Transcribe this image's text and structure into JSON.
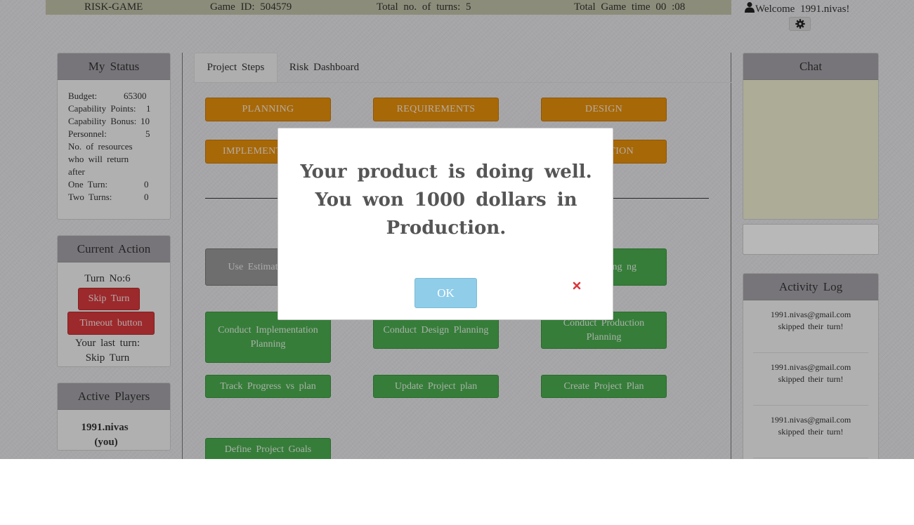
{
  "topbar": {
    "app_name": "RISK-GAME",
    "game_id": "Game ID: 504579",
    "turns": "Total no. of turns: 5",
    "game_time": "Total Game time 00 :08"
  },
  "user": {
    "welcome": "Welcome  1991.nivas!"
  },
  "status": {
    "title": "My Status",
    "rows": [
      {
        "label": "Budget:",
        "value": "65300"
      },
      {
        "label": "Capability Points:",
        "value": "1"
      },
      {
        "label": "Capability Bonus:",
        "value": "10"
      },
      {
        "label": "Personnel:",
        "value": "5"
      }
    ],
    "returning_label_1": "No. of resources",
    "returning_label_2": "who will return",
    "returning_label_3": "after",
    "one_turn_label": "One Turn:",
    "one_turn_value": "0",
    "two_turns_label": "Two Turns:",
    "two_turns_value": "0"
  },
  "current_action": {
    "title": "Current Action",
    "turn_no": "Turn No:6",
    "skip_turn": "Skip Turn",
    "timeout": "Timeout button",
    "last_turn_label": "Your last turn:",
    "last_turn_value": "Skip Turn"
  },
  "active_players": {
    "title": "Active Players",
    "player_name": "1991.nivas",
    "player_tag": "(you)"
  },
  "tabs": [
    "Project Steps",
    "Risk Dashboard"
  ],
  "phases": [
    "PLANNING",
    "REQUIREMENTS",
    "DESIGN",
    "IMPLEMENT",
    "TION"
  ],
  "actions": {
    "use_estimates": "Use Estimates Plan",
    "testing_partial": "esting ng",
    "conduct_impl": "Conduct Implementation Planning",
    "conduct_design": "Conduct Design Planning",
    "conduct_production": "Conduct Production Planning",
    "track_progress": "Track Progress vs plan",
    "update_plan": "Update Project plan",
    "create_plan": "Create Project Plan",
    "define_goals": "Define Project Goals"
  },
  "chat": {
    "title": "Chat",
    "input_value": ""
  },
  "activity_log": {
    "title": "Activity Log",
    "entries": [
      {
        "email": "1991.nivas@gmail.com",
        "text": "skipped their turn!"
      },
      {
        "email": "1991.nivas@gmail.com",
        "text": "skipped their turn!"
      },
      {
        "email": "1991.nivas@gmail.com",
        "text": "skipped their turn!"
      }
    ]
  },
  "modal": {
    "message": "Your product is doing well. You won 1000 dollars in Production.",
    "ok_label": "OK"
  },
  "colors": {
    "topbar": "#c3c3a9",
    "panel_header": "#a6a3a9",
    "phase_button": "#e8900c",
    "action_button": "#4cad4f",
    "danger_button": "#d9393c",
    "ok_button": "#8fcde9",
    "chat_background": "#efefd1"
  },
  "icons": {
    "user": "user-icon",
    "settings": "gear-icon",
    "close": "close-icon"
  }
}
